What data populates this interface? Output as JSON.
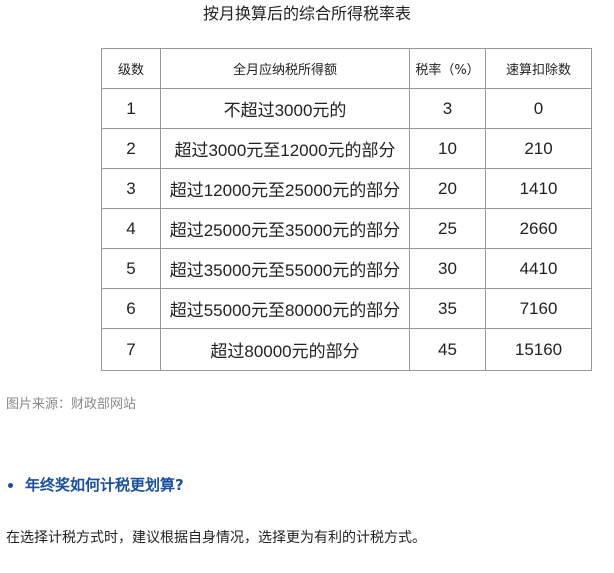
{
  "table": {
    "title": "按月换算后的综合所得税率表",
    "headers": [
      "级数",
      "全月应纳税所得额",
      "税率（%）",
      "速算扣除数"
    ],
    "rows": [
      [
        "1",
        "不超过3000元的",
        "3",
        "0"
      ],
      [
        "2",
        "超过3000元至12000元的部分",
        "10",
        "210"
      ],
      [
        "3",
        "超过12000元至25000元的部分",
        "20",
        "1410"
      ],
      [
        "4",
        "超过25000元至35000元的部分",
        "25",
        "2660"
      ],
      [
        "5",
        "超过35000元至55000元的部分",
        "30",
        "4410"
      ],
      [
        "6",
        "超过55000元至80000元的部分",
        "35",
        "7160"
      ],
      [
        "7",
        "超过80000元的部分",
        "45",
        "15160"
      ]
    ]
  },
  "source_caption": "图片来源：财政部网站",
  "section": {
    "heading": "年终奖如何计税更划算?",
    "body": "在选择计税方式时，建议根据自身情况，选择更为有利的计税方式。"
  },
  "colors": {
    "heading_blue": "#1a4fa0",
    "border_gray": "#999999",
    "caption_gray": "#888888"
  }
}
